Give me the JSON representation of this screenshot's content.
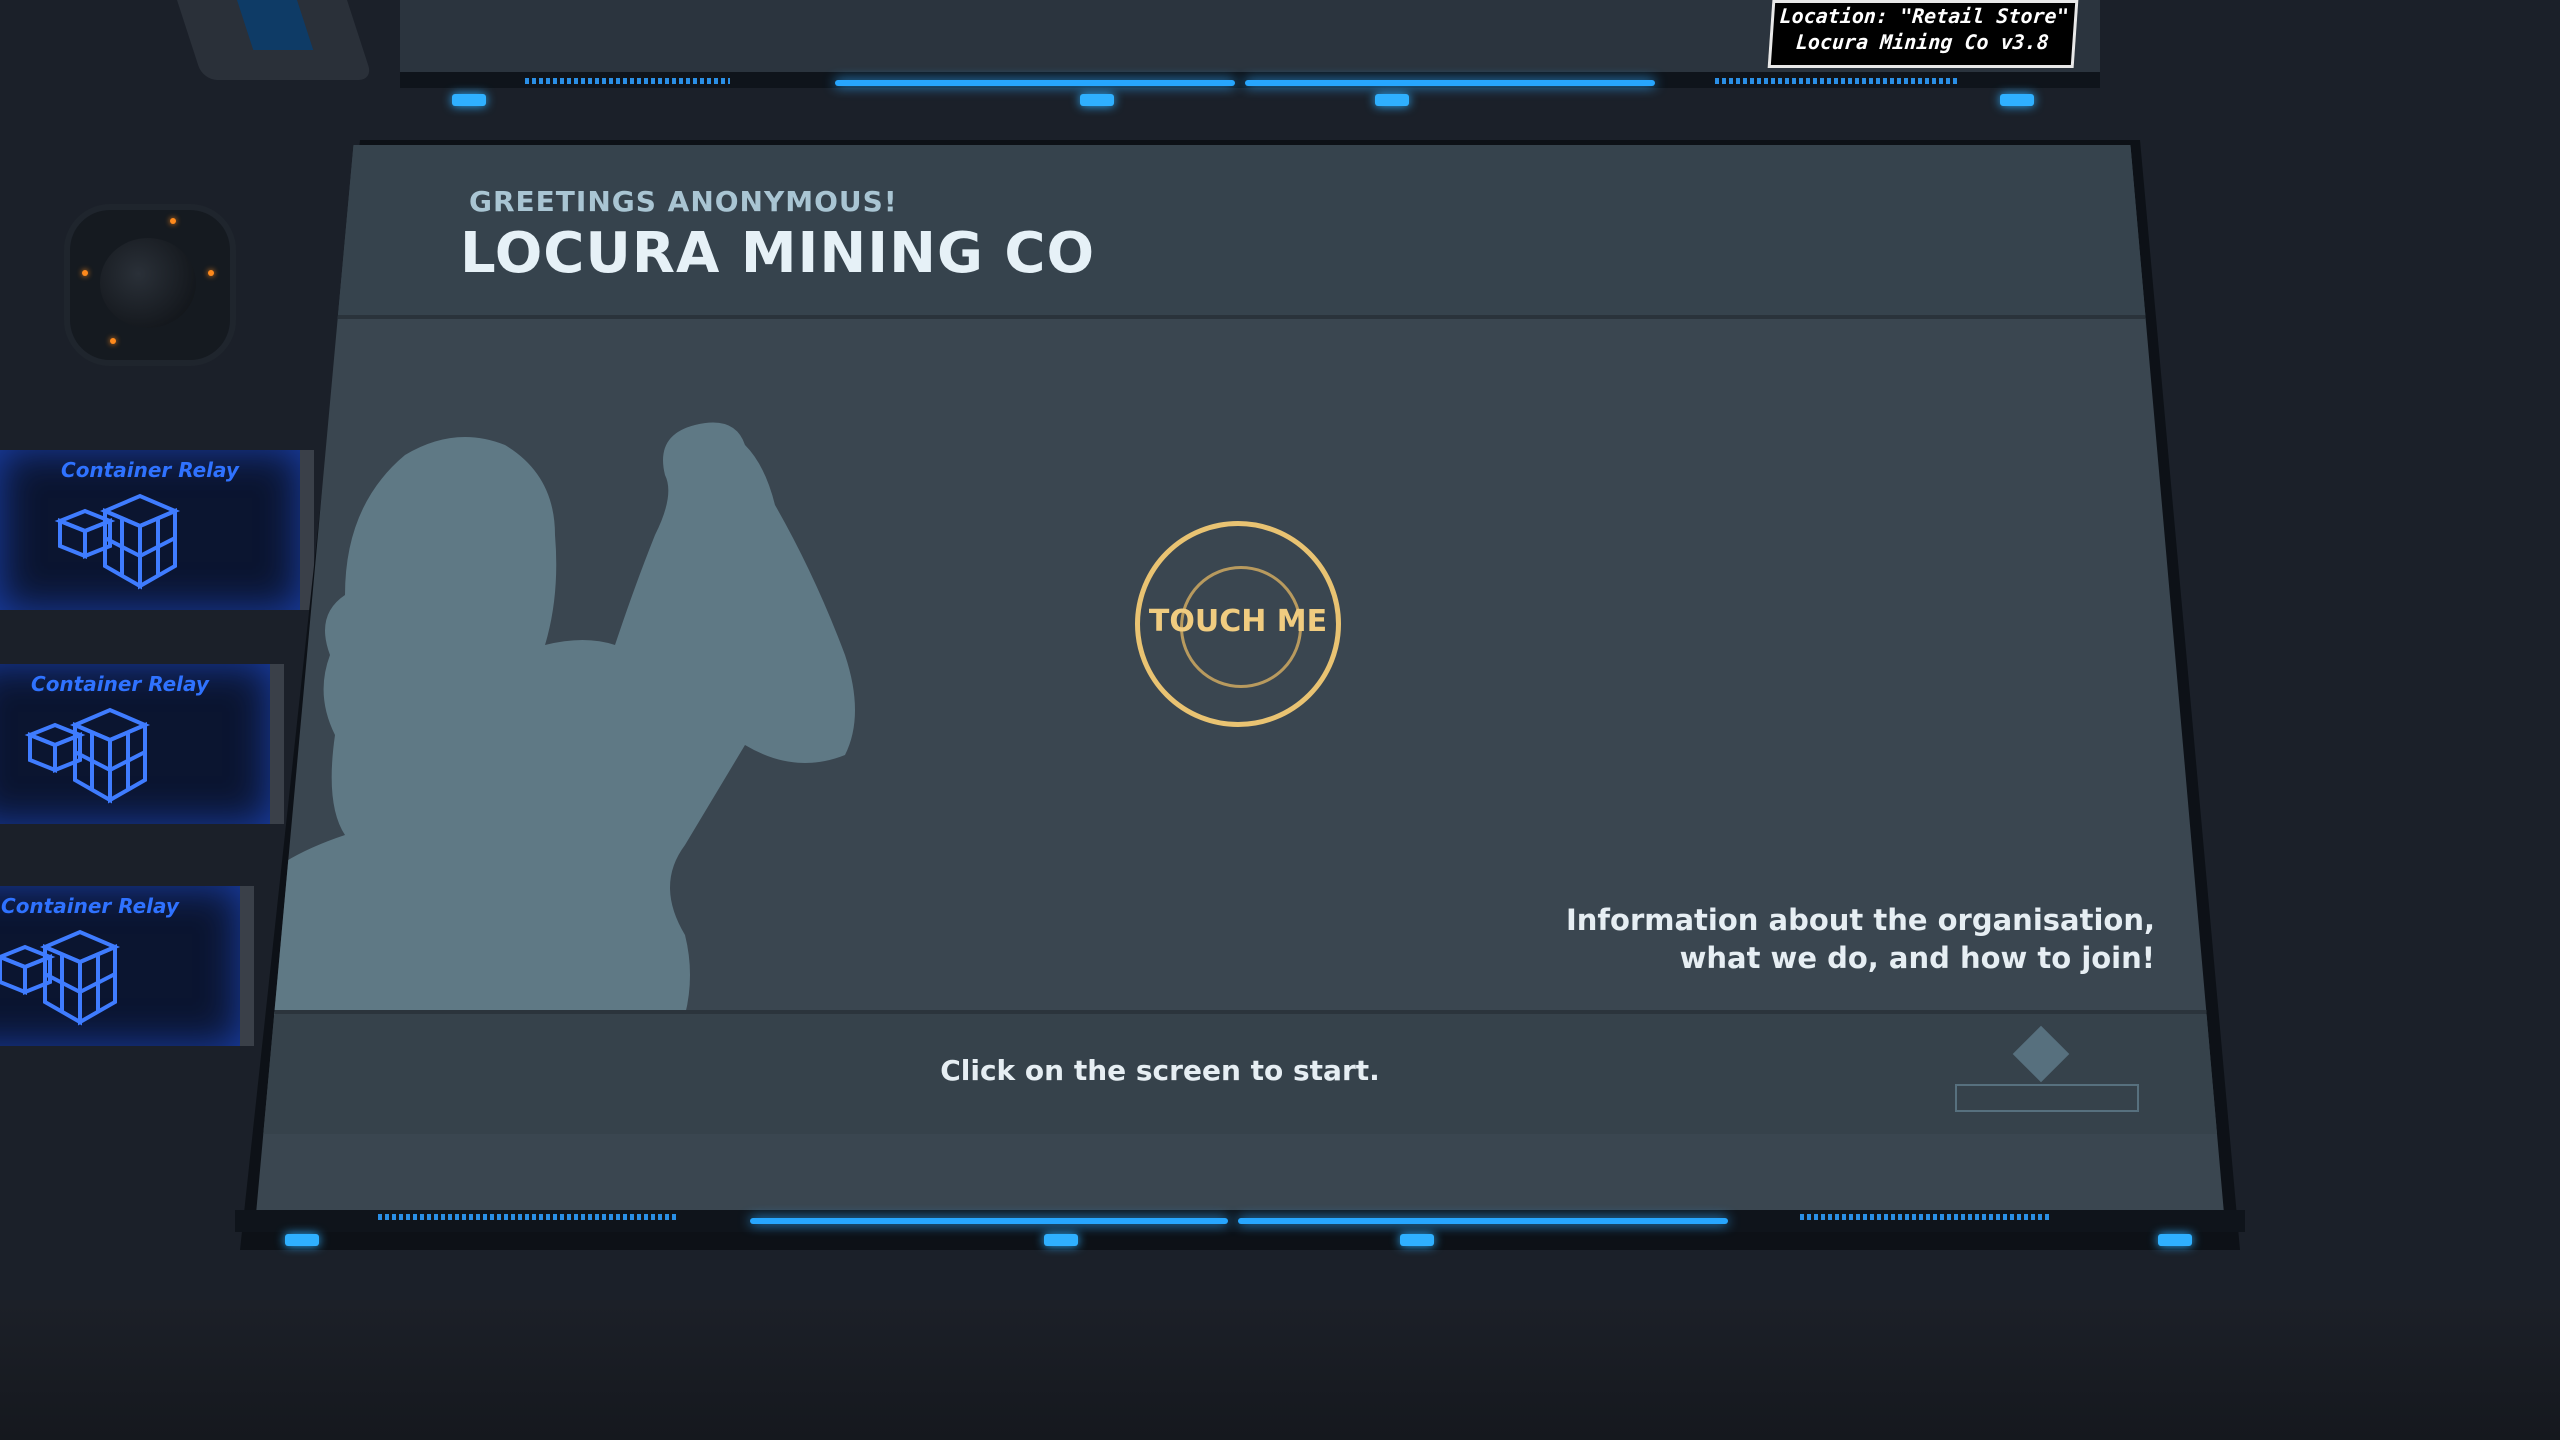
{
  "location_label": {
    "line1": "Location: \"Retail Store\"",
    "line2": "Locura Mining Co v3.8"
  },
  "relays": [
    {
      "title": "Container Relay"
    },
    {
      "title": "Container Relay"
    },
    {
      "title": "Container Relay"
    }
  ],
  "screen": {
    "greeting": "GREETINGS ANONYMOUS!",
    "title": "LOCURA MINING CO",
    "touch_button": "TOUCH ME",
    "info_line1": "Information about the organisation,",
    "info_line2": "what we do, and how to join!",
    "footer": "Click on the screen to start."
  },
  "colors": {
    "accent_glow": "#27a6ff",
    "touch_ring": "#e9c372",
    "relay_blue": "#2f72ff"
  }
}
